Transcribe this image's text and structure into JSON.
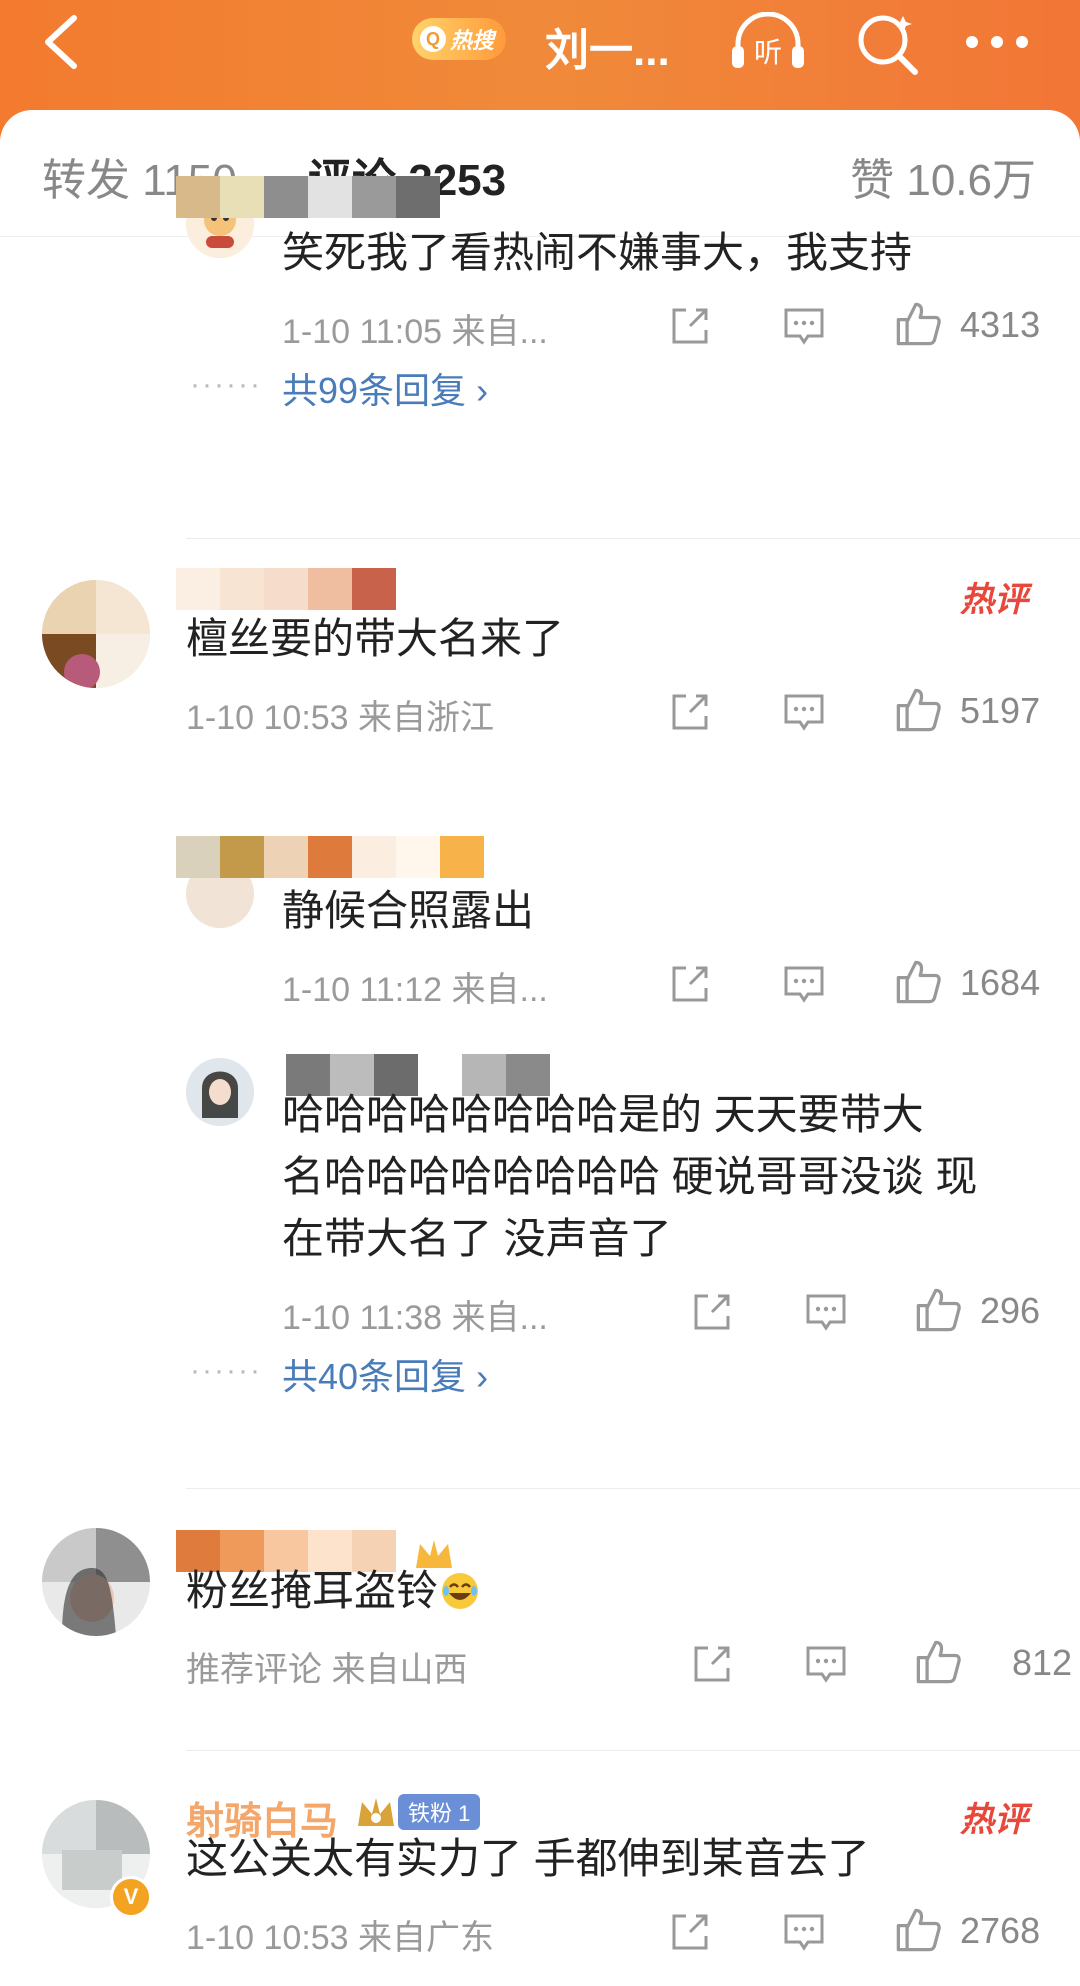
{
  "header": {
    "hot_label": "热搜",
    "title": "刘一...",
    "listen_label": "听"
  },
  "tabs": {
    "repost": "转发 1150",
    "comment": "评论 2253",
    "like": "赞 10.6万"
  },
  "comments": [
    {
      "text": "笑死我了看热闹不嫌事大，我支持",
      "meta": "1-10 11:05  来自...",
      "likes": "4313",
      "replies": "共99条回复"
    },
    {
      "text": "檀丝要的带大名来了",
      "meta": "1-10 10:53  来自浙江",
      "likes": "5197",
      "hot": "热评"
    },
    {
      "text": "静候合照露出",
      "meta": "1-10 11:12  来自...",
      "likes": "1684"
    },
    {
      "text_line1": "哈哈哈哈哈哈哈哈是的 天天要带大",
      "text_line2": "名哈哈哈哈哈哈哈哈 硬说哥哥没谈 现",
      "text_line3": "在带大名了 没声音了",
      "meta": "1-10 11:38  来自...",
      "likes": "296",
      "replies": "共40条回复"
    },
    {
      "text": "粉丝掩耳盗铃",
      "meta": "推荐评论  来自山西",
      "likes": "812"
    },
    {
      "name": "射骑白马",
      "fan_badge": "铁粉 1",
      "text": "这公关太有实力了 手都伸到某音去了",
      "meta": "1-10 10:53  来自广东",
      "likes": "2768",
      "hot": "热评"
    }
  ],
  "colors": {
    "brand_orange": "#f37a2e",
    "link_blue": "#4a7cba",
    "hot_red": "#e8483b"
  }
}
